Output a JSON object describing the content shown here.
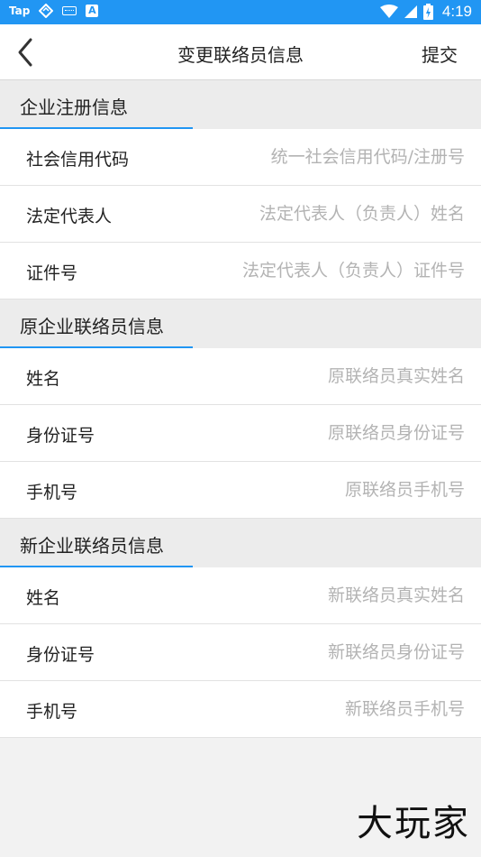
{
  "status_bar": {
    "app_label": "Tap",
    "time": "4:19",
    "background": "#2196f3",
    "icons": [
      "tap-app-icon",
      "sync-icon",
      "keyboard-icon",
      "a-box-icon",
      "wifi-icon",
      "cell-signal-icon",
      "battery-icon"
    ]
  },
  "nav": {
    "title": "变更联络员信息",
    "submit_label": "提交",
    "back_icon": "chevron-left-icon"
  },
  "sections": [
    {
      "title": "企业注册信息",
      "rows": [
        {
          "label": "社会信用代码",
          "placeholder": "统一社会信用代码/注册号",
          "value": ""
        },
        {
          "label": "法定代表人",
          "placeholder": "法定代表人（负责人）姓名",
          "value": ""
        },
        {
          "label": "证件号",
          "placeholder": "法定代表人（负责人）证件号",
          "value": ""
        }
      ]
    },
    {
      "title": "原企业联络员信息",
      "rows": [
        {
          "label": "姓名",
          "placeholder": "原联络员真实姓名",
          "value": ""
        },
        {
          "label": "身份证号",
          "placeholder": "原联络员身份证号",
          "value": ""
        },
        {
          "label": "手机号",
          "placeholder": "原联络员手机号",
          "value": ""
        }
      ]
    },
    {
      "title": "新企业联络员信息",
      "rows": [
        {
          "label": "姓名",
          "placeholder": "新联络员真实姓名",
          "value": ""
        },
        {
          "label": "身份证号",
          "placeholder": "新联络员身份证号",
          "value": ""
        },
        {
          "label": "手机号",
          "placeholder": "新联络员手机号",
          "value": ""
        }
      ]
    }
  ],
  "watermark": "大玩家",
  "colors": {
    "accent": "#2196f3",
    "section_background": "#ececec",
    "placeholder_text": "#b3b3b3"
  }
}
